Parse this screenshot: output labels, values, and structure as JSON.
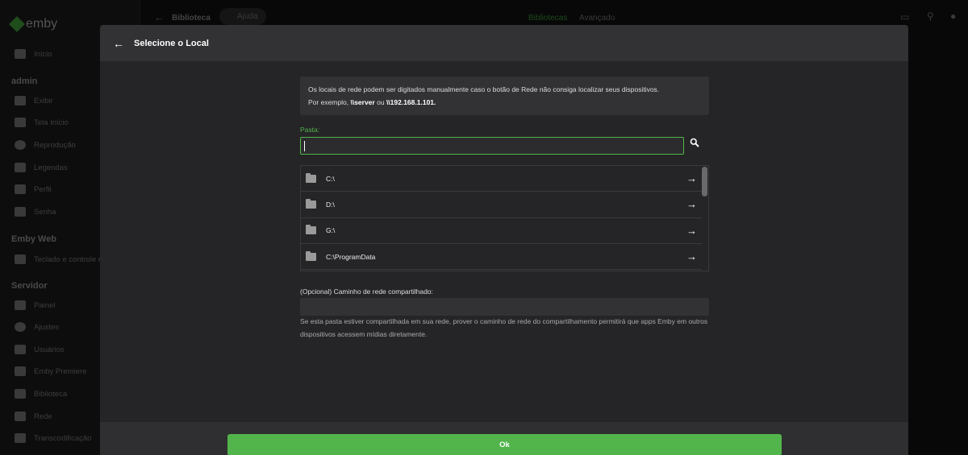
{
  "app": {
    "logo": "emby"
  },
  "sidebar": {
    "home": "Início",
    "sections": [
      {
        "title": "admin",
        "items": [
          "Exibir",
          "Tela Início",
          "Reprodução",
          "Legendas",
          "Perfil",
          "Senha"
        ]
      },
      {
        "title": "Emby Web",
        "items": [
          "Teclado e controle remoto"
        ]
      },
      {
        "title": "Servidor",
        "items": [
          "Painel",
          "Ajustes",
          "Usuários",
          "Emby Premiere",
          "Biblioteca",
          "Rede",
          "Transcodificação"
        ]
      }
    ]
  },
  "topbar": {
    "title": "Biblioteca",
    "help": "Ajuda",
    "tabs": [
      "Bibliotecas",
      "Avançado"
    ]
  },
  "dialog": {
    "title": "Selecione o Local",
    "info_text": "Os locais de rede podem ser digitados manualmente caso o botão de Rede não consiga localizar seus dispositivos.",
    "info_prefix": "Por exemplo,",
    "info_ex1": "\\\\server",
    "info_or": "ou",
    "info_ex2": "\\\\192.168.1.101",
    "folder_label": "Pasta:",
    "folder_value": "",
    "paths": [
      "C:\\",
      "D:\\",
      "G:\\",
      "C:\\ProgramData"
    ],
    "share_label": "(Opcional) Caminho de rede compartilhado:",
    "share_value": "",
    "share_help": "Se esta pasta estiver compartilhada em sua rede, prover o caminho de rede do compartilhamento permitirá que apps Emby em outros dispositivos acessem mídias diretamente.",
    "ok": "Ok"
  },
  "colors": {
    "accent": "#52b54b"
  }
}
